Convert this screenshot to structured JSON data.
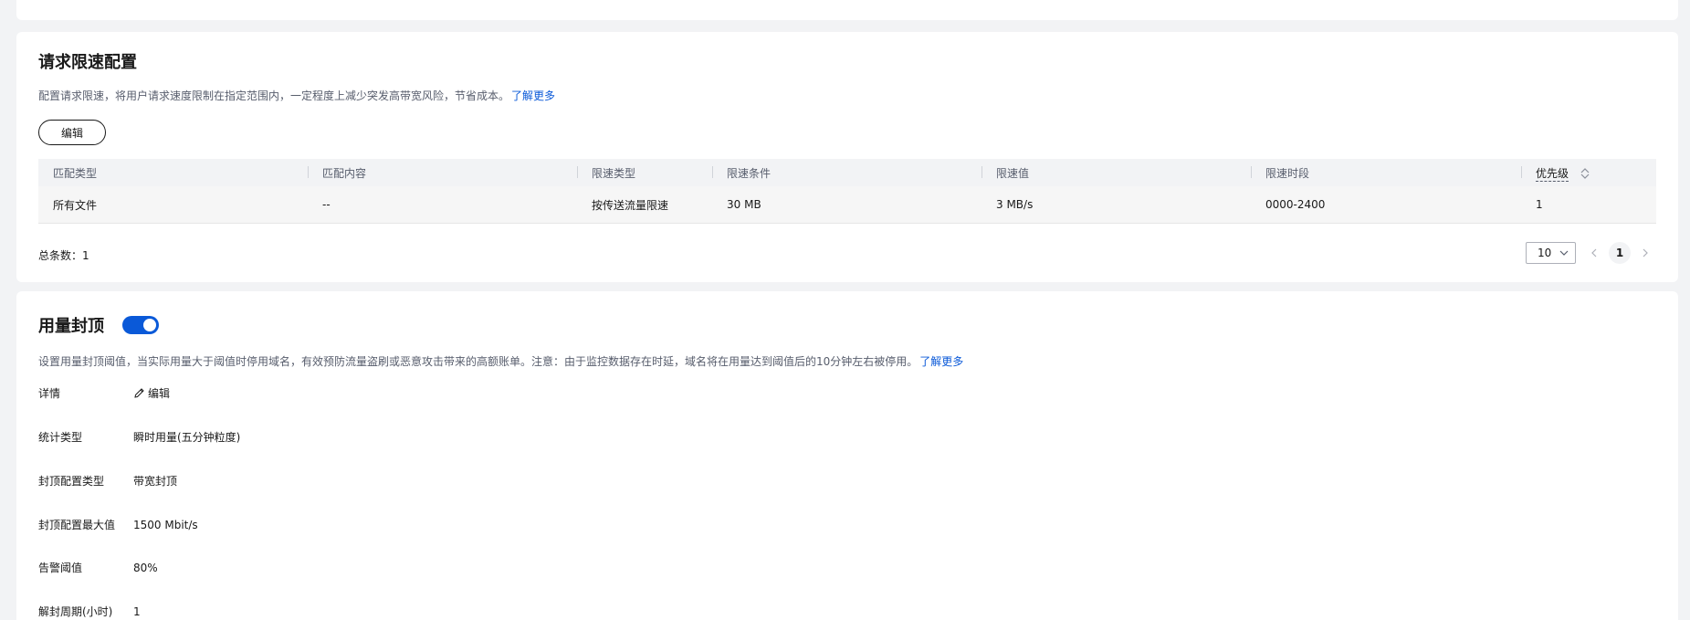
{
  "rate_limit": {
    "title": "请求限速配置",
    "description": "配置请求限速，将用户请求速度限制在指定范围内，一定程度上减少突发高带宽风险，节省成本。",
    "learn_more": "了解更多",
    "edit_label": "编辑",
    "table": {
      "columns": [
        "匹配类型",
        "匹配内容",
        "限速类型",
        "限速条件",
        "限速值",
        "限速时段",
        "优先级"
      ],
      "rows": [
        [
          "所有文件",
          "--",
          "按传送流量限速",
          "30 MB",
          "3 MB/s",
          "0000-2400",
          "1"
        ]
      ]
    },
    "total_label": "总条数：1",
    "page_size": "10",
    "current_page": "1"
  },
  "usage_cap": {
    "title": "用量封顶",
    "enabled": true,
    "description": "设置用量封顶阈值，当实际用量大于阈值时停用域名，有效预防流量盗刷或恶意攻击带来的高额账单。注意：由于监控数据存在时延，域名将在用量达到阈值后的10分钟左右被停用。",
    "learn_more": "了解更多",
    "details": [
      {
        "label": "详情",
        "value": "编辑"
      },
      {
        "label": "统计类型",
        "value": "瞬时用量(五分钟粒度)"
      },
      {
        "label": "封顶配置类型",
        "value": "带宽封顶"
      },
      {
        "label": "封顶配置最大值",
        "value": "1500 Mbit/s"
      },
      {
        "label": "告警阈值",
        "value": "80%"
      },
      {
        "label": "解封周期(小时)",
        "value": "1"
      }
    ]
  },
  "colors": {
    "accent": "#0a59d8",
    "background": "#f2f3f5"
  }
}
